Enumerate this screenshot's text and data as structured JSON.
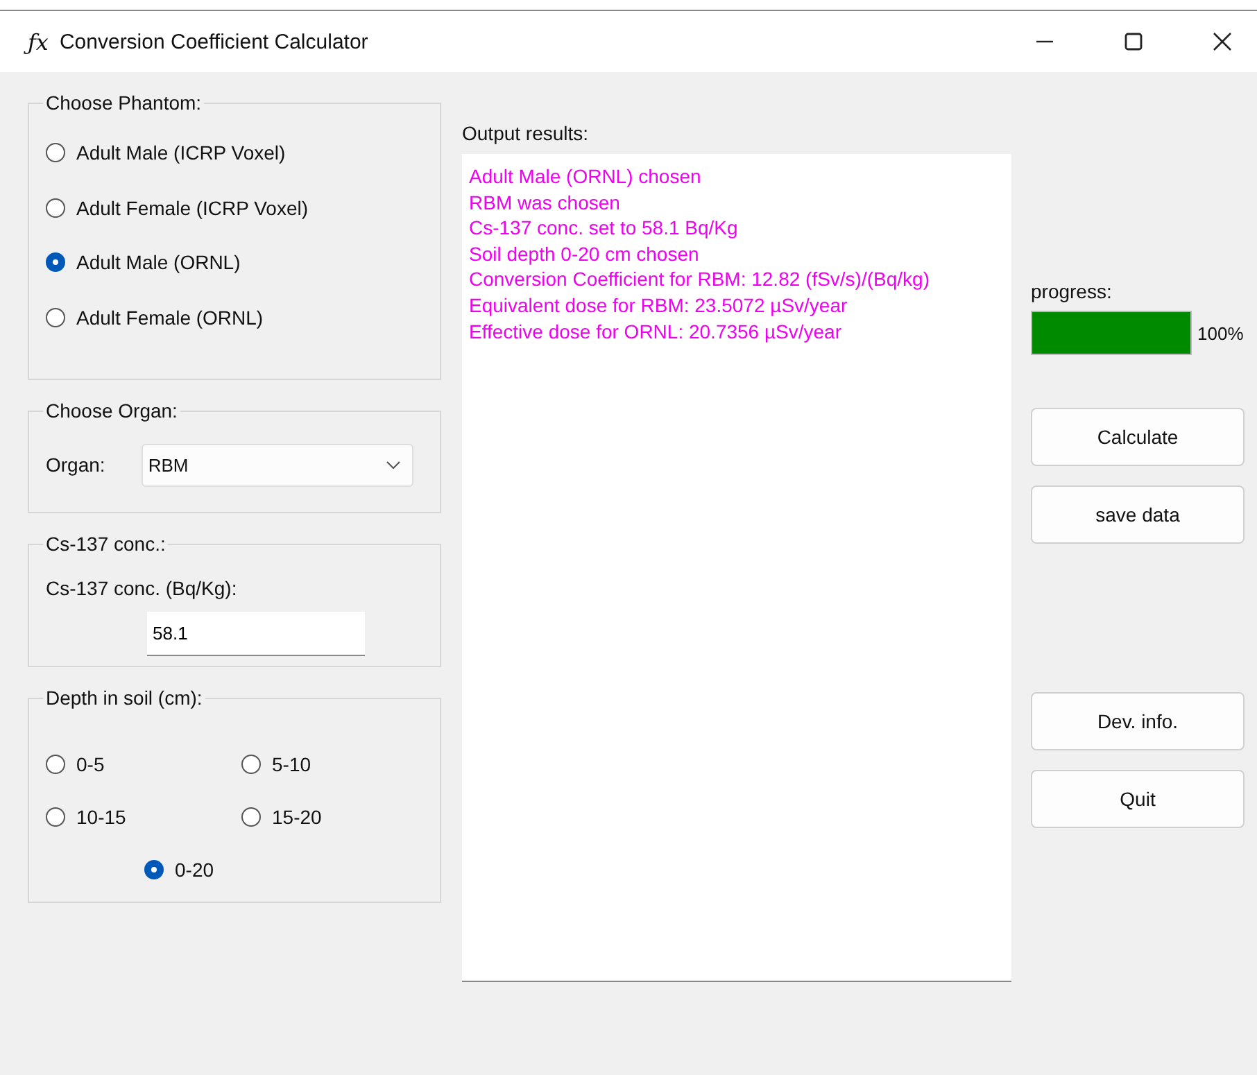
{
  "window": {
    "icon": "ƒx",
    "title": "Conversion Coefficient Calculator"
  },
  "phantom": {
    "title": "Choose Phantom:",
    "options": [
      {
        "label": "Adult Male (ICRP Voxel)",
        "selected": false
      },
      {
        "label": "Adult Female (ICRP Voxel)",
        "selected": false
      },
      {
        "label": "Adult Male (ORNL)",
        "selected": true
      },
      {
        "label": "Adult Female (ORNL)",
        "selected": false
      }
    ]
  },
  "organ": {
    "title": "Choose Organ:",
    "label": "Organ:",
    "value": "RBM"
  },
  "concentration": {
    "title": "Cs-137 conc.:",
    "label": "Cs-137 conc. (Bq/Kg):",
    "value": "58.1"
  },
  "depth": {
    "title": "Depth in soil (cm):",
    "options": [
      {
        "label": "0-5",
        "selected": false
      },
      {
        "label": "5-10",
        "selected": false
      },
      {
        "label": "10-15",
        "selected": false
      },
      {
        "label": "15-20",
        "selected": false
      },
      {
        "label": "0-20",
        "selected": true
      }
    ]
  },
  "output": {
    "label": "Output results:",
    "lines": [
      "Adult Male (ORNL) chosen",
      "RBM was chosen",
      "Cs-137 conc. set to 58.1 Bq/Kg",
      "Soil depth 0-20 cm chosen",
      "Conversion Coefficient for RBM: 12.82 (fSv/s)/(Bq/kg)",
      "Equivalent dose for RBM: 23.5072 µSv/year",
      "Effective dose for ORNL: 20.7356 µSv/year"
    ]
  },
  "progress": {
    "label": "progress:",
    "level": 1,
    "reading": "100%"
  },
  "actions": [
    "Calculate",
    "save data"
  ],
  "footer_buttons": [
    "Dev. info.",
    "Quit"
  ]
}
